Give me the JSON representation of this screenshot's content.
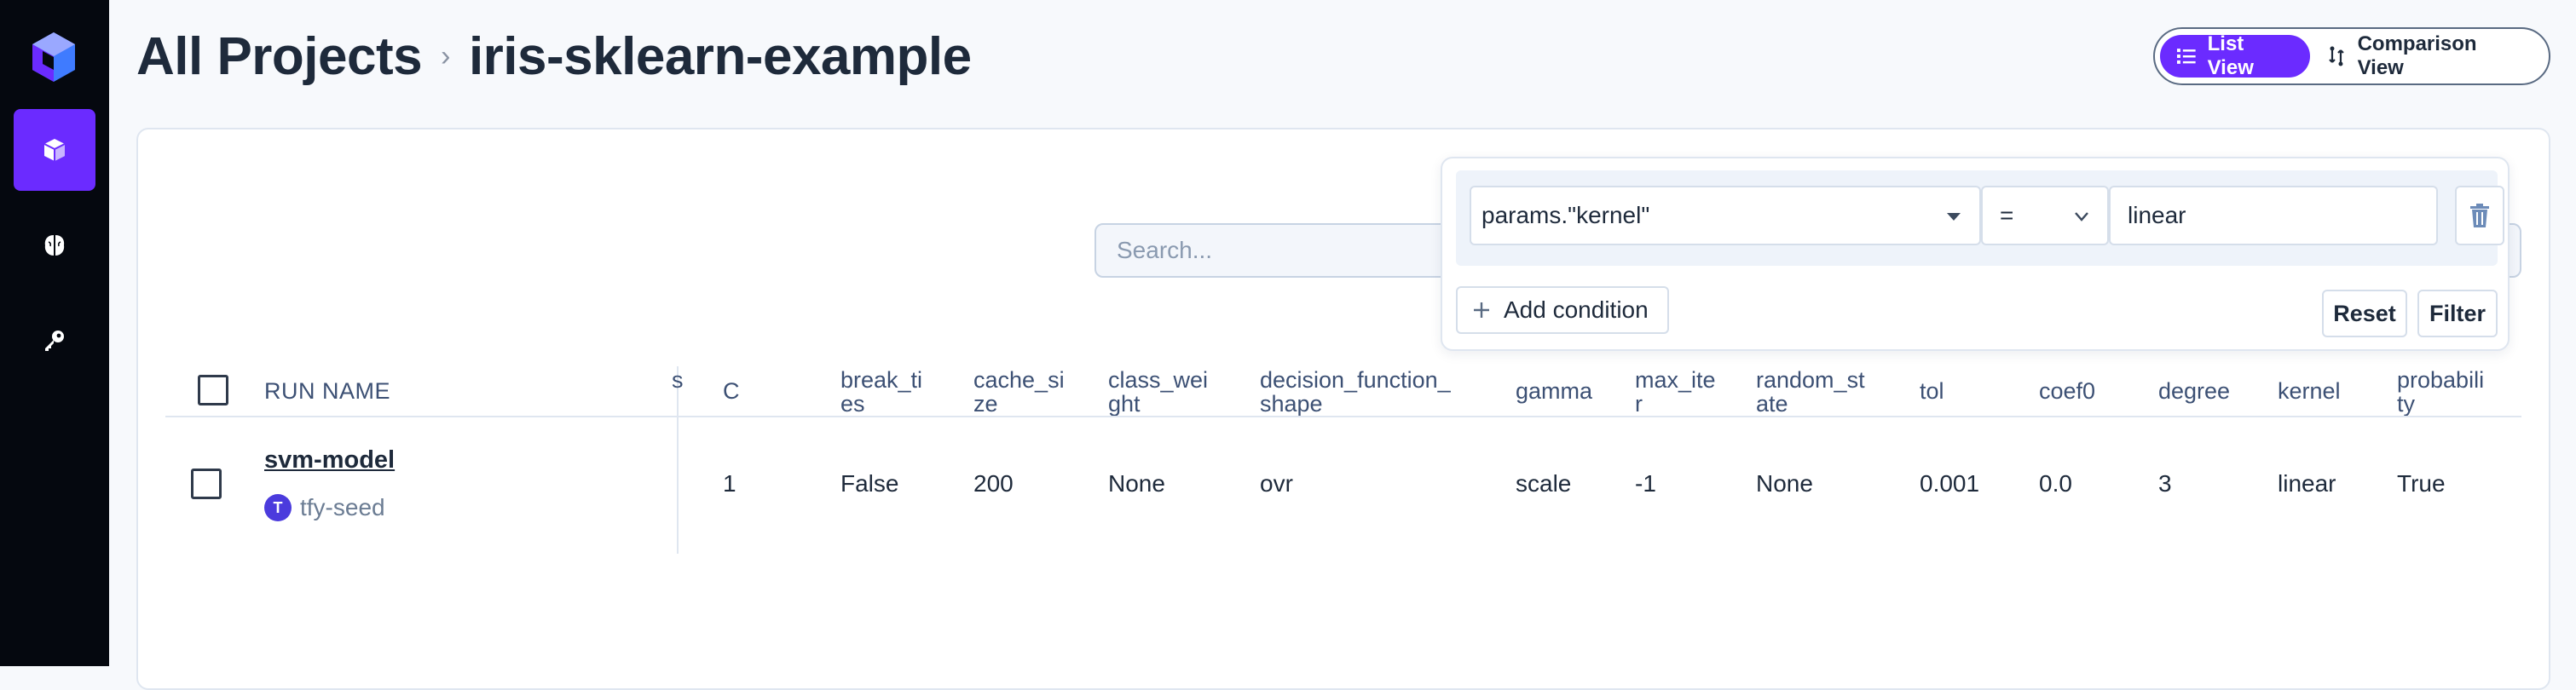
{
  "breadcrumb": {
    "root": "All Projects",
    "separator": "›",
    "current": "iris-sklearn-example"
  },
  "view_toggle": {
    "list_label": "List View",
    "comparison_label": "Comparison View"
  },
  "sidebar": {
    "items": [
      {
        "icon": "cube-icon",
        "active": true
      },
      {
        "icon": "brain-icon",
        "active": false
      },
      {
        "icon": "key-icon",
        "active": false
      }
    ]
  },
  "search": {
    "placeholder": "Search..."
  },
  "filter": {
    "field_value": "params.\"kernel\"",
    "operator": "=",
    "value": "linear",
    "add_condition_label": "Add condition",
    "reset_label": "Reset",
    "filter_label": "Filter"
  },
  "table": {
    "headers": {
      "run_name": "RUN NAME",
      "truncated": "s",
      "c": "C",
      "break_ties": "break_ti\nes",
      "cache_size": "cache_si\nze",
      "class_weight": "class_wei\nght",
      "decision_function_shape": "decision_function_\nshape",
      "gamma": "gamma",
      "max_iter": "max_ite\nr",
      "random_state": "random_st\nate",
      "tol": "tol",
      "coef0": "coef0",
      "degree": "degree",
      "kernel": "kernel",
      "probability": "probabili\nty"
    },
    "row": {
      "run_name": "svm-model",
      "owner_initial": "T",
      "owner": "tfy-seed",
      "c": "1",
      "break_ties": "False",
      "cache_size": "200",
      "class_weight": "None",
      "decision_function_shape": "ovr",
      "gamma": "scale",
      "max_iter": "-1",
      "random_state": "None",
      "tol": "0.001",
      "coef0": "0.0",
      "degree": "3",
      "kernel": "linear",
      "probability": "True"
    }
  },
  "colors": {
    "accent": "#6b2bff",
    "sidebar_bg": "#05080f"
  }
}
